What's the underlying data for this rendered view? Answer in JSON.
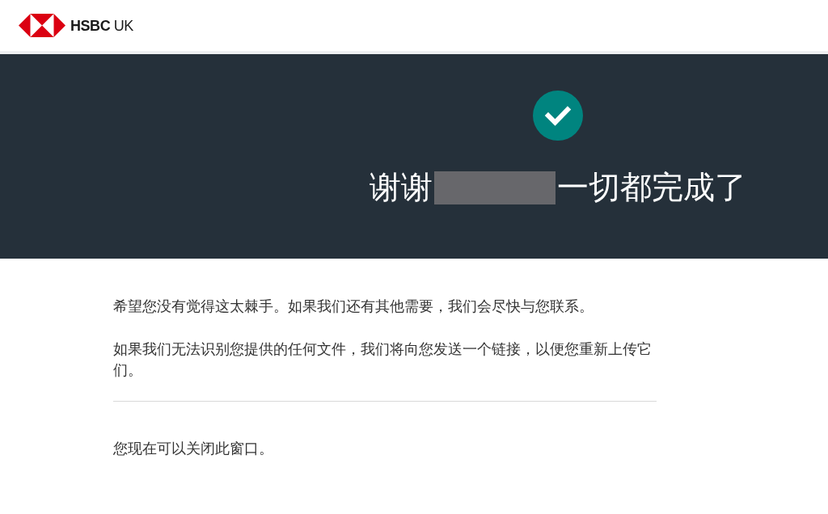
{
  "header": {
    "logo_text": "**HSBC** UK"
  },
  "hero": {
    "title_start": "谢谢",
    "redacted": true,
    "title_end": "一切都完成了"
  },
  "paragraphs": [
    "希望您没有觉得这太棘手。如果我们还有其他需要，我们会尽快与您联系。",
    "如果我们无法识别您提供的任何文件，我们将向您发送一个链接，以便您重新上传它们。"
  ],
  "closing_note": "您现在可以关闭此窗口。"
}
